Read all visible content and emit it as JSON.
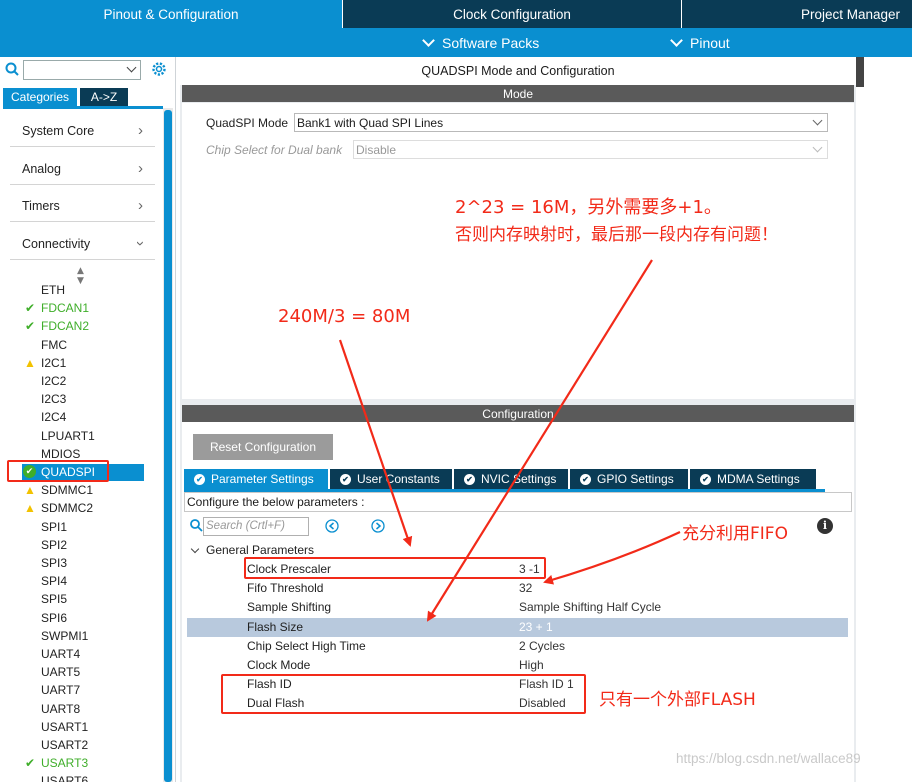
{
  "top_tabs": [
    "Pinout & Configuration",
    "Clock Configuration",
    "Project Manager"
  ],
  "sub_menu": [
    "Software Packs",
    "Pinout"
  ],
  "sidebar": {
    "search_placeholder": "",
    "view_buttons": [
      "Categories",
      "A->Z"
    ],
    "categories": [
      "System Core",
      "Analog",
      "Timers",
      "Connectivity"
    ],
    "items": [
      {
        "label": "ETH",
        "status": "none"
      },
      {
        "label": "FDCAN1",
        "status": "ok"
      },
      {
        "label": "FDCAN2",
        "status": "ok"
      },
      {
        "label": "FMC",
        "status": "none"
      },
      {
        "label": "I2C1",
        "status": "warn"
      },
      {
        "label": "I2C2",
        "status": "none"
      },
      {
        "label": "I2C3",
        "status": "none"
      },
      {
        "label": "I2C4",
        "status": "none"
      },
      {
        "label": "LPUART1",
        "status": "none"
      },
      {
        "label": "MDIOS",
        "status": "none"
      },
      {
        "label": "QUADSPI",
        "status": "selected"
      },
      {
        "label": "SDMMC1",
        "status": "warn"
      },
      {
        "label": "SDMMC2",
        "status": "warn"
      },
      {
        "label": "SPI1",
        "status": "none"
      },
      {
        "label": "SPI2",
        "status": "none"
      },
      {
        "label": "SPI3",
        "status": "none"
      },
      {
        "label": "SPI4",
        "status": "none"
      },
      {
        "label": "SPI5",
        "status": "none"
      },
      {
        "label": "SPI6",
        "status": "none"
      },
      {
        "label": "SWPMI1",
        "status": "none"
      },
      {
        "label": "UART4",
        "status": "none"
      },
      {
        "label": "UART5",
        "status": "none"
      },
      {
        "label": "UART7",
        "status": "none"
      },
      {
        "label": "UART8",
        "status": "none"
      },
      {
        "label": "USART1",
        "status": "none"
      },
      {
        "label": "USART2",
        "status": "none"
      },
      {
        "label": "USART3",
        "status": "ok"
      },
      {
        "label": "USART6",
        "status": "none"
      }
    ]
  },
  "main": {
    "title": "QUADSPI Mode and Configuration",
    "mode_header": "Mode",
    "mode": {
      "quadspi_mode_label": "QuadSPI Mode",
      "quadspi_mode_value": "Bank1 with Quad SPI Lines",
      "chip_select_label": "Chip Select for Dual bank",
      "chip_select_value": "Disable"
    },
    "config_header": "Configuration",
    "reset_button": "Reset Configuration",
    "tabs": [
      "Parameter Settings",
      "User Constants",
      "NVIC Settings",
      "GPIO Settings",
      "MDMA Settings"
    ],
    "configure_text": "Configure the below parameters :",
    "search_placeholder": "Search (Crtl+F)",
    "group_label": "General Parameters",
    "params": [
      {
        "name": "Clock Prescaler",
        "value": "3 -1"
      },
      {
        "name": "Fifo Threshold",
        "value": "32"
      },
      {
        "name": "Sample Shifting",
        "value": "Sample Shifting Half Cycle"
      },
      {
        "name": "Flash Size",
        "value": "23 + 1"
      },
      {
        "name": "Chip Select High Time",
        "value": "2 Cycles"
      },
      {
        "name": "Clock Mode",
        "value": "High"
      },
      {
        "name": "Flash ID",
        "value": "Flash ID 1"
      },
      {
        "name": "Dual Flash",
        "value": "Disabled"
      }
    ]
  },
  "annotations": {
    "note1_line1": "2^23 = 16M，另外需要多+1。",
    "note1_line2": "否则内存映射时，最后那一段内存有问题！",
    "note2": "240M/3 = 80M",
    "note3": "充分利用FIFO",
    "note4": "只有一个外部FLASH"
  },
  "watermark": "https://blog.csdn.net/wallace89",
  "colors": {
    "accent": "#0a8fd0",
    "dark_tab": "#0a3b55",
    "annotation_red": "#f22a19",
    "ok_green": "#3fae2a",
    "warn_yellow": "#f2c200"
  }
}
